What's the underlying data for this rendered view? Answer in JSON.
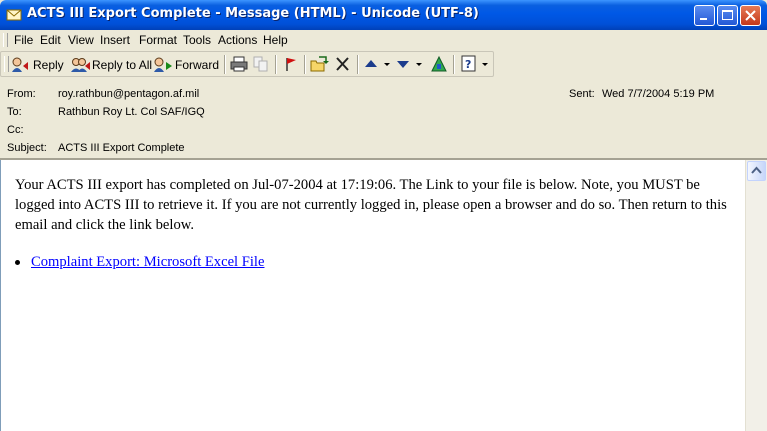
{
  "window": {
    "title": "ACTS III Export Complete - Message (HTML)  - Unicode (UTF-8)"
  },
  "menu": {
    "file": "File",
    "edit": "Edit",
    "view": "View",
    "insert": "Insert",
    "format": "Format",
    "tools": "Tools",
    "actions": "Actions",
    "help": "Help"
  },
  "toolbar": {
    "reply": "Reply",
    "reply_all": "Reply to All",
    "forward": "Forward"
  },
  "header": {
    "from_label": "From:",
    "from_value": "roy.rathbun@pentagon.af.mil",
    "to_label": "To:",
    "to_value": "Rathbun Roy Lt. Col SAF/IGQ",
    "cc_label": "Cc:",
    "cc_value": "",
    "subject_label": "Subject:",
    "subject_value": "ACTS III Export Complete",
    "sent_label": "Sent:",
    "sent_value": "Wed 7/7/2004 5:19 PM"
  },
  "body": {
    "paragraph": "Your ACTS III export has completed on Jul-07-2004 at 17:19:06. The Link to your file is below. Note, you MUST be logged into ACTS III to retrieve it. If you are not currently logged in, please open a browser and do so. Then return to this email and click the link below.",
    "link_text": "Complaint Export: Microsoft Excel File"
  },
  "colors": {
    "titlebar": "#0058E6",
    "chrome": "#ECE9D8",
    "link": "#0000FF"
  }
}
